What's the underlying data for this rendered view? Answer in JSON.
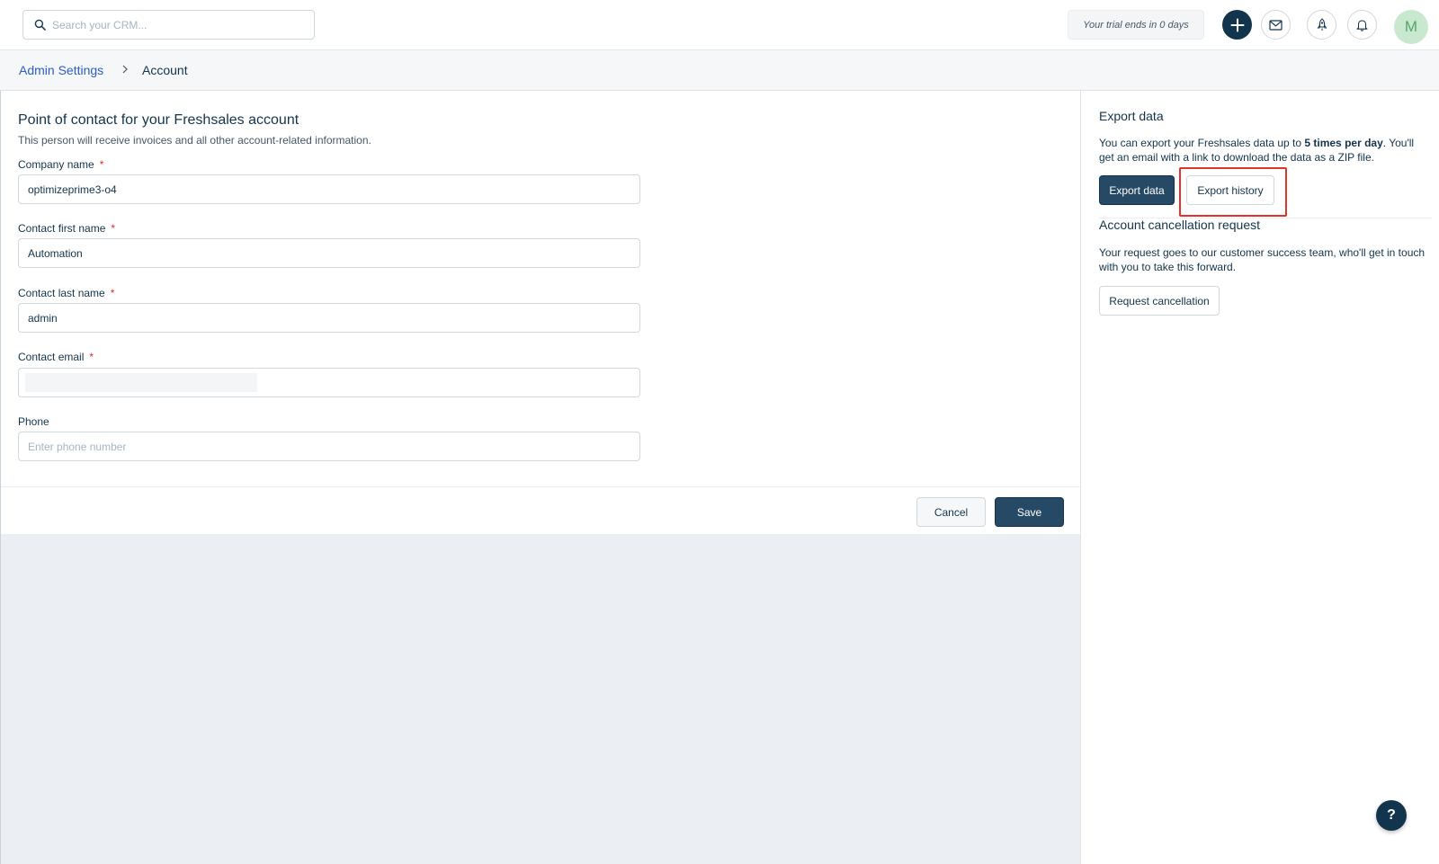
{
  "header": {
    "search_placeholder": "Search your CRM...",
    "trial_text": "Your trial ends in 0 days",
    "avatar_initial": "M"
  },
  "breadcrumb": {
    "parent": "Admin Settings",
    "current": "Account"
  },
  "form": {
    "title": "Point of contact for your Freshsales account",
    "subtitle": "This person will receive invoices and all other account-related information.",
    "required_marker": "*",
    "fields": {
      "company": {
        "label": "Company name",
        "value": "optimizeprime3-o4"
      },
      "first_name": {
        "label": "Contact first name",
        "value": "Automation"
      },
      "last_name": {
        "label": "Contact last name",
        "value": "admin"
      },
      "email": {
        "label": "Contact email",
        "value": ""
      },
      "phone": {
        "label": "Phone",
        "value": "",
        "placeholder": "Enter phone number"
      }
    },
    "cancel_label": "Cancel",
    "save_label": "Save"
  },
  "export": {
    "title": "Export data",
    "text_before": "You can export your Freshsales data up to ",
    "text_bold": "5 times per day",
    "text_after": ". You'll get an email with a link to download the data as a ZIP file.",
    "export_label": "Export data",
    "history_label": "Export history"
  },
  "cancellation": {
    "title": "Account cancellation request",
    "text": "Your request goes to our customer success team, who'll get in touch with you to take this forward.",
    "button_label": "Request cancellation"
  },
  "help": {
    "label": "?"
  },
  "colors": {
    "primary": "#12344d",
    "link": "#2c5cc5",
    "required": "#d72d30",
    "highlight": "#e0352e",
    "avatar_bg": "#c8e8cf"
  }
}
